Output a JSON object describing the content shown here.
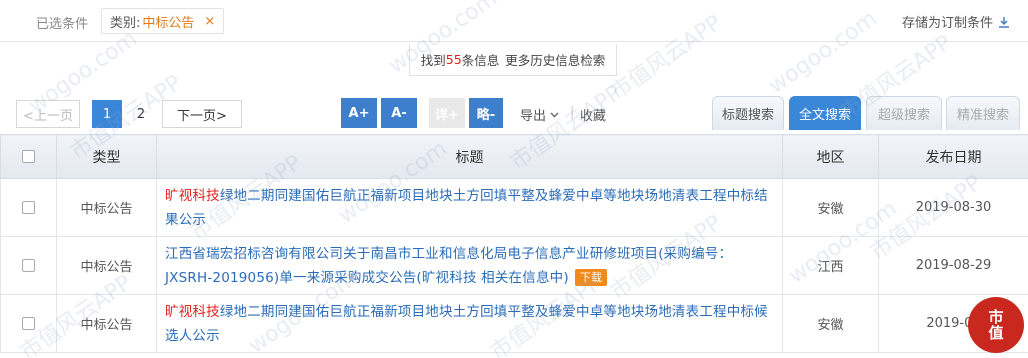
{
  "filter": {
    "label": "已选条件",
    "tag_key": "类别:",
    "tag_value": "中标公告",
    "tag_remove": "×",
    "save_label": "存储为订制条件"
  },
  "result": {
    "prefix": "找到",
    "count": "55",
    "suffix": "条信息",
    "more": "更多历史信息检索"
  },
  "pagination": {
    "prev": "<上一页",
    "pages": [
      "1",
      "2"
    ],
    "next": "下一页>"
  },
  "toolbar": {
    "font_up": "A+",
    "font_down": "A-",
    "detail": "详+",
    "brief": "略-",
    "export": "导出",
    "favorite": "收藏"
  },
  "tabs": [
    "标题搜索",
    "全文搜索",
    "超级搜索",
    "精准搜索"
  ],
  "table": {
    "headers": [
      "类型",
      "标题",
      "地区",
      "发布日期"
    ],
    "rows": [
      {
        "type": "中标公告",
        "title_highlight": "旷视科技",
        "title_rest": "绿地二期同建国佑巨航正福新项目地块土方回填平整及蜂爱中卓等地块场地清表工程中标结果公示",
        "region": "安徽",
        "date": "2019-08-30"
      },
      {
        "type": "中标公告",
        "title_plain": "江西省瑞宏招标咨询有限公司关于南昌市工业和信息化局电子信息产业研修班项目(采购编号：JXSRH-2019056)单一来源采购成交公告(旷视科技 相关在信息中)",
        "download": "下载",
        "region": "江西",
        "date": "2019-08-29"
      },
      {
        "type": "中标公告",
        "title_highlight": "旷视科技",
        "title_rest": "绿地二期同建国佑巨航正福新项目地块土方回填平整及蜂爱中卓等地块场地清表工程中标候选人公示",
        "region": "安徽",
        "date": "2019-08"
      }
    ]
  },
  "watermark": {
    "text": "市值风云APP",
    "url": "wogoo.com",
    "logo_top": "市",
    "logo_bottom": "值"
  },
  "colors": {
    "accent": "#3a86d8",
    "highlight": "#e02020",
    "tag": "#e07b1a"
  }
}
